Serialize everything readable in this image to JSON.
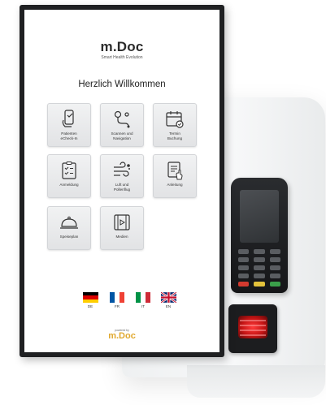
{
  "brand": {
    "name": "m.Doc",
    "tagline": "Smart Health Evolution",
    "footer_caption": "powered by",
    "footer_name": "m.Doc",
    "footer_color": "#e0a82e"
  },
  "welcome": "Herzlich Willkommen",
  "tiles": [
    {
      "label": "Patienten\neCheck-In",
      "icon": "phone-checkin-icon"
    },
    {
      "label": "Scannen und\nNavigation",
      "icon": "navigation-route-icon"
    },
    {
      "label": "Termin\nBuchung",
      "icon": "calendar-icon"
    },
    {
      "label": "Anmeldung",
      "icon": "clipboard-icon"
    },
    {
      "label": "Luft und\nPollenflug",
      "icon": "wind-icon"
    },
    {
      "label": "Anleitung",
      "icon": "manual-icon"
    },
    {
      "label": "Speiseplan",
      "icon": "food-cloche-icon"
    },
    {
      "label": "Medien",
      "icon": "film-icon"
    }
  ],
  "languages": [
    {
      "code": "DE",
      "icon": "germany-flag-icon"
    },
    {
      "code": "FR",
      "icon": "france-flag-icon"
    },
    {
      "code": "IT",
      "icon": "italy-flag-icon"
    },
    {
      "code": "EN",
      "icon": "uk-flag-icon"
    }
  ],
  "colors": {
    "bezel": "#1f2022",
    "tile_bg": "#e9eaec",
    "scanner_light": "#e02020"
  }
}
